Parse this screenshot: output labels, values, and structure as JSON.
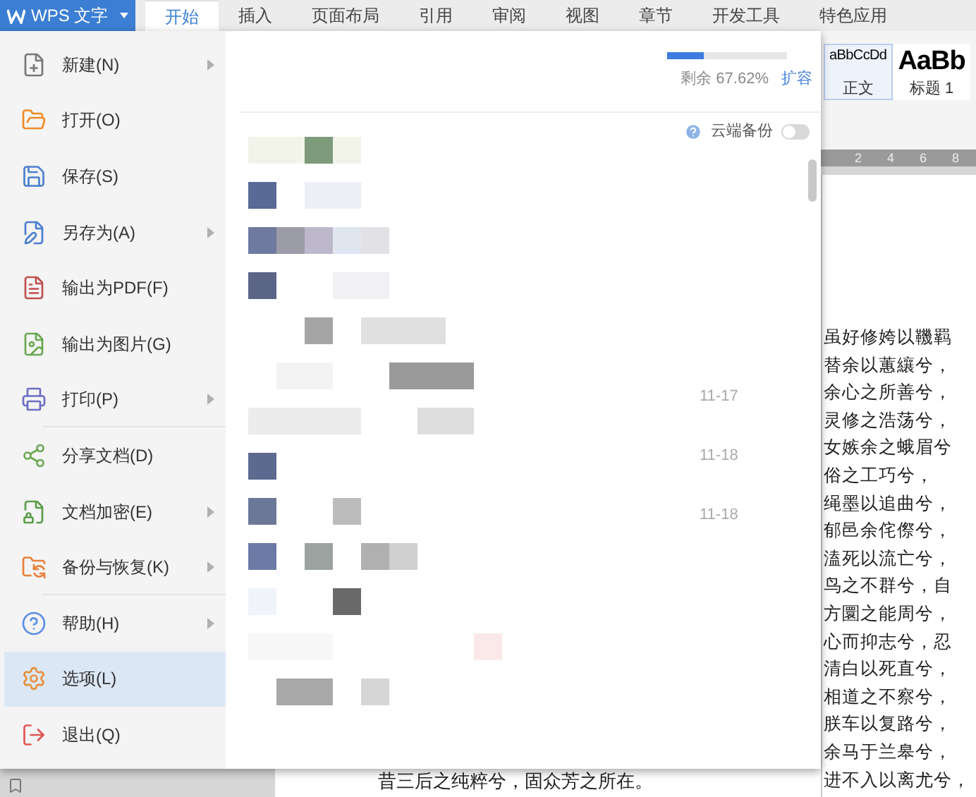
{
  "app_button": {
    "label": "WPS 文字"
  },
  "tabs": [
    {
      "label": "开始",
      "selected": true
    },
    {
      "label": "插入",
      "selected": false
    },
    {
      "label": "页面布局",
      "selected": false
    },
    {
      "label": "引用",
      "selected": false
    },
    {
      "label": "审阅",
      "selected": false
    },
    {
      "label": "视图",
      "selected": false
    },
    {
      "label": "章节",
      "selected": false
    },
    {
      "label": "开发工具",
      "selected": false
    },
    {
      "label": "特色应用",
      "selected": false
    }
  ],
  "styles": [
    {
      "sample": "aBbCcDd",
      "name": "正文",
      "selected": true
    },
    {
      "sample": "AaBb",
      "name": "标题 1",
      "selected": false
    }
  ],
  "ruler": [
    "2",
    "4",
    "6",
    "8"
  ],
  "menu": {
    "groups": [
      [
        {
          "label": "新建(N)",
          "submenu": true,
          "selected": false
        },
        {
          "label": "打开(O)",
          "submenu": false,
          "selected": false
        },
        {
          "label": "保存(S)",
          "submenu": false,
          "selected": false
        },
        {
          "label": "另存为(A)",
          "submenu": true,
          "selected": false
        },
        {
          "label": "输出为PDF(F)",
          "submenu": false,
          "selected": false
        },
        {
          "label": "输出为图片(G)",
          "submenu": false,
          "selected": false
        },
        {
          "label": "打印(P)",
          "submenu": true,
          "selected": false
        }
      ],
      [
        {
          "label": "分享文档(D)",
          "submenu": false,
          "selected": false
        },
        {
          "label": "文档加密(E)",
          "submenu": true,
          "selected": false
        },
        {
          "label": "备份与恢复(K)",
          "submenu": true,
          "selected": false
        }
      ],
      [
        {
          "label": "帮助(H)",
          "submenu": true,
          "selected": false
        },
        {
          "label": "选项(L)",
          "submenu": false,
          "selected": true
        },
        {
          "label": "退出(Q)",
          "submenu": false,
          "selected": false
        }
      ]
    ]
  },
  "storage": {
    "level": 0.3,
    "text": "剩余 67.62%",
    "link": "扩容"
  },
  "cloud_backup": {
    "label": "云端备份",
    "on": false
  },
  "recent_dates": [
    "11-17",
    "11-18",
    "11-18"
  ],
  "document": {
    "column_1": [
      "昔三后之纯粹兮，固众芳之所在。"
    ],
    "column_2": [
      "虽好修姱以鞿羁",
      "替余以蕙纕兮，",
      "余心之所善兮，",
      "灵修之浩荡兮，",
      "女嫉余之蛾眉兮",
      "俗之工巧兮，",
      "绳墨以追曲兮，",
      "郁邑余侘傺兮，",
      "溘死以流亡兮，",
      "鸟之不群兮，自",
      "方圜之能周兮，",
      "心而抑志兮，忍",
      "清白以死直兮，",
      "相道之不察兮，",
      "朕车以复路兮，",
      "余马于兰皋兮，",
      "进不入以离尤兮，"
    ]
  }
}
